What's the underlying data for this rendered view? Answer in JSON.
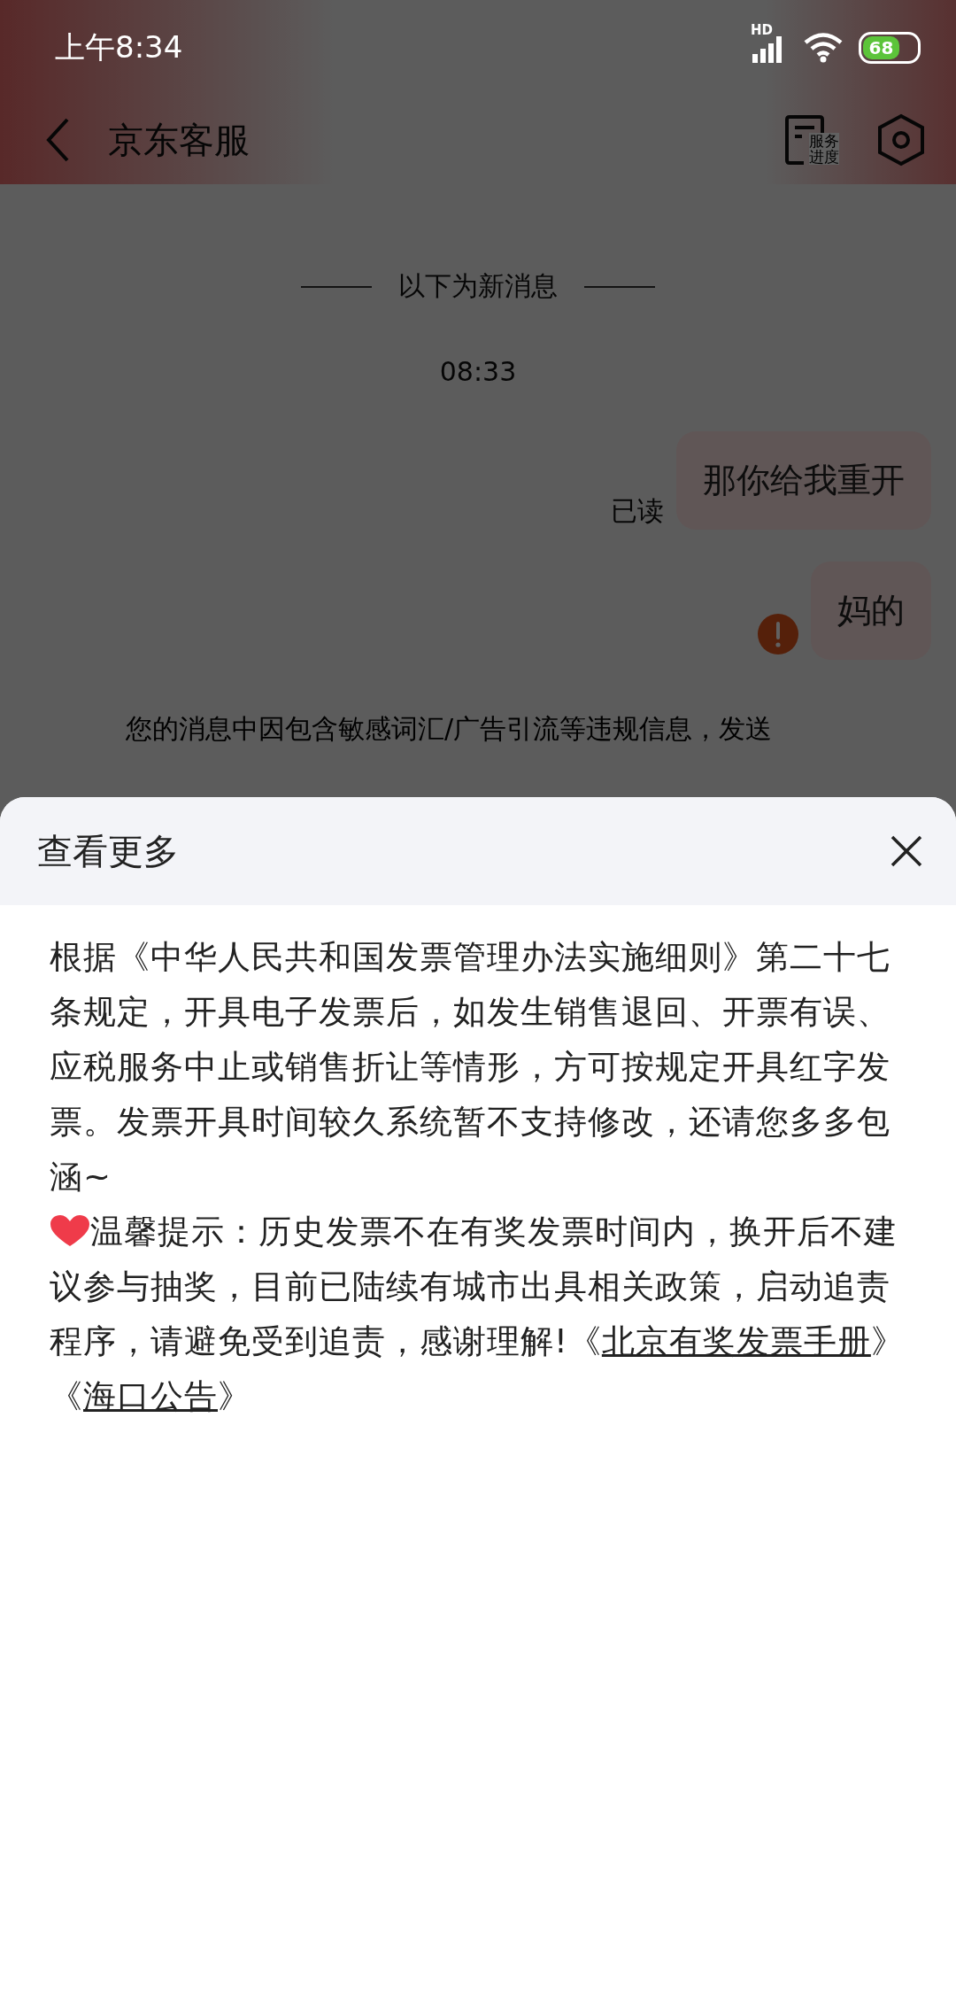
{
  "status_bar": {
    "time": "上午8:34",
    "network_label": "HD",
    "battery": "68"
  },
  "header": {
    "title": "京东客服",
    "service_button": {
      "lines": [
        "服务",
        "进度"
      ]
    }
  },
  "chat": {
    "divider": "以下为新消息",
    "time": "08:33",
    "messages": [
      {
        "text": "那你给我重开",
        "receipt": "已读",
        "failed": false
      },
      {
        "text": "妈的",
        "failed": true
      }
    ],
    "notice": "您的消息中因包含敏感词汇/广告引流等违规信息，发送"
  },
  "sheet": {
    "title": "查看更多",
    "paragraphs": [
      {
        "parts": [
          {
            "kind": "text",
            "text": "根据《中华人民共和国发票管理办法实施细则》第二十七条规定，开具电子发票后，如发生销售退回、开票有误、应税服务中止或销售折让等情形，方可按规定开具红字发票。发票开具时间较久系统暂不支持修改，还请您多多包涵~"
          }
        ]
      },
      {
        "parts": [
          {
            "kind": "heart"
          },
          {
            "kind": "text",
            "text": "温馨提示：历史发票不在有奖发票时间内，换开后不建议参与抽奖，目前已陆续有城市出具相关政策，启动追责程序，请避免受到追责，感谢理解!《"
          },
          {
            "kind": "link",
            "text": "北京有奖发票手册"
          },
          {
            "kind": "text",
            "text": "》《"
          },
          {
            "kind": "link",
            "text": "海口公告"
          },
          {
            "kind": "text",
            "text": "》"
          }
        ]
      }
    ]
  }
}
